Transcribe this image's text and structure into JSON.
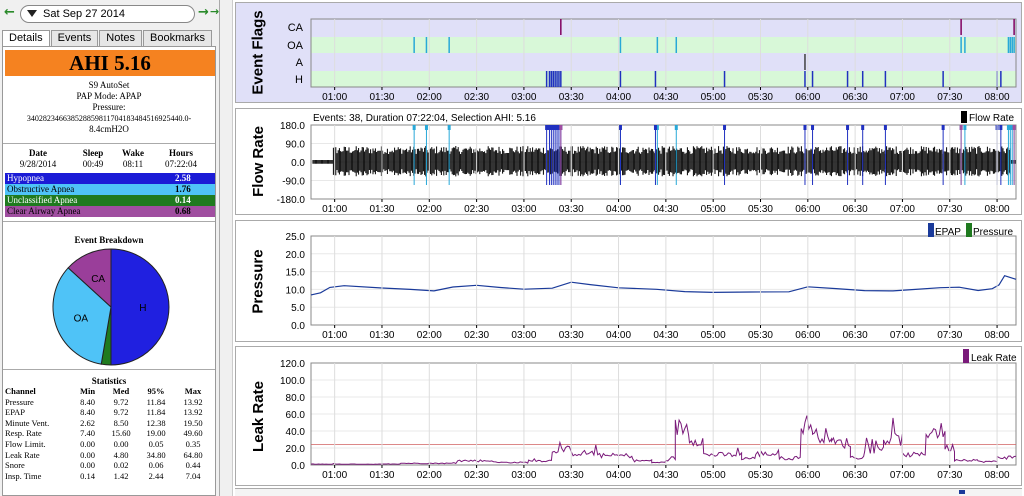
{
  "date_nav": {
    "prev_icon": "←",
    "next_icon": "→",
    "last_icon": "→|",
    "date": "Sat Sep 27 2014"
  },
  "tabs": [
    {
      "label": "Details",
      "active": true
    },
    {
      "label": "Events"
    },
    {
      "label": "Notes"
    },
    {
      "label": "Bookmarks"
    }
  ],
  "summary": {
    "ahi": "AHI 5.16",
    "machine": "S9 AutoSet",
    "pap_mode": "PAP Mode: APAP",
    "pressure_label": "Pressure:",
    "pressure_value": "34028234663852885981170418348451692544 0.0-8.4cmH2O",
    "pressure_line1": "340282346638528859811704183484516925440.0-",
    "pressure_line2": "8.4cmH2O"
  },
  "session": {
    "headers": [
      "Date",
      "Sleep",
      "Wake",
      "Hours"
    ],
    "row": [
      "9/28/2014",
      "00:49",
      "08:11",
      "07:22:04"
    ]
  },
  "indices": [
    {
      "label": "Hypopnea",
      "value": "2.58",
      "color": "#1b1bd6",
      "text": "#ffffff"
    },
    {
      "label": "Obstructive Apnea",
      "value": "1.76",
      "color": "#4fc3f7",
      "text": "#000000"
    },
    {
      "label": "Unclassified Apnea",
      "value": "0.14",
      "color": "#1f7a1f",
      "text": "#ffffff"
    },
    {
      "label": "Clear Airway Apnea",
      "value": "0.68",
      "color": "#a04ea0",
      "text": "#000000"
    }
  ],
  "breakdown": {
    "title": "Event Breakdown",
    "slices": [
      {
        "label": "H",
        "value": 50.0,
        "color": "#2020e0"
      },
      {
        "label": "UA",
        "value": 2.7,
        "color": "#1f7a1f"
      },
      {
        "label": "OA",
        "value": 34.1,
        "color": "#4fc3f7"
      },
      {
        "label": "CA",
        "value": 13.2,
        "color": "#9a3e9a"
      }
    ]
  },
  "stats": {
    "title": "Statistics",
    "headers": [
      "Channel",
      "Min",
      "Med",
      "95%",
      "Max"
    ],
    "rows": [
      [
        "Pressure",
        "8.40",
        "9.72",
        "11.84",
        "13.92"
      ],
      [
        "EPAP",
        "8.40",
        "9.72",
        "11.84",
        "13.92"
      ],
      [
        "Minute Vent.",
        "2.62",
        "8.50",
        "12.38",
        "19.50"
      ],
      [
        "Resp. Rate",
        "7.40",
        "15.60",
        "19.00",
        "49.60"
      ],
      [
        "Flow Limit.",
        "0.00",
        "0.00",
        "0.05",
        "0.35"
      ],
      [
        "Leak Rate",
        "0.00",
        "4.80",
        "34.80",
        "64.80"
      ],
      [
        "Snore",
        "0.00",
        "0.02",
        "0.06",
        "0.44"
      ],
      [
        "Insp. Time",
        "0.14",
        "1.42",
        "2.44",
        "7.04"
      ]
    ]
  },
  "time_ticks": [
    "01:00",
    "01:30",
    "02:00",
    "02:30",
    "03:00",
    "03:30",
    "04:00",
    "04:30",
    "05:00",
    "05:30",
    "06:00",
    "06:30",
    "07:00",
    "07:30",
    "08:00"
  ],
  "event_flags": {
    "title": "Event Flags",
    "rows": [
      "CA",
      "OA",
      "A",
      "H"
    ],
    "ca_times": [
      3.39,
      7.62,
      8.18
    ],
    "oa_times": [
      1.84,
      1.97,
      2.21,
      4.02,
      4.41,
      4.61,
      7.62,
      7.66,
      8.12,
      8.14,
      8.16,
      8.18
    ],
    "a_times": [
      5.97
    ],
    "h_times": [
      3.24,
      3.27,
      3.29,
      3.31,
      3.33,
      3.35,
      3.37,
      3.39,
      4.02,
      4.39,
      5.12,
      5.97,
      6.05,
      6.42,
      6.58,
      6.82,
      7.43,
      8.0,
      8.04
    ]
  },
  "flow_rate": {
    "title": "Flow Rate",
    "info": "Events: 38, Duration 07:22:04, Selection AHI: 5.16",
    "legend": "Flow Rate",
    "yticks": [
      "180.0",
      "90.0",
      "0.0",
      "-90.0",
      "-180.0"
    ]
  },
  "pressure": {
    "title": "Pressure",
    "legend": [
      "EPAP",
      "Pressure"
    ],
    "yticks": [
      "25.0",
      "20.0",
      "15.0",
      "10.0",
      "5.0",
      "0.0"
    ]
  },
  "leak": {
    "title": "Leak Rate",
    "legend": "Leak Rate",
    "yticks": [
      "120.0",
      "100.0",
      "80.0",
      "60.0",
      "40.0",
      "20.0",
      "0.0"
    ]
  },
  "colors": {
    "accent": "#f58220",
    "flags_bg": "#e0e0f8",
    "flag_row": "#d8f8d8",
    "epap": "#1a3a9a",
    "leak": "#7a1a7a"
  }
}
